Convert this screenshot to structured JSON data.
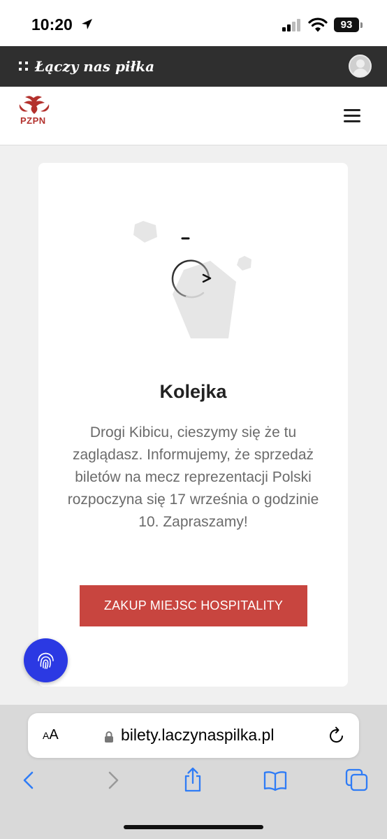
{
  "status_bar": {
    "time": "10:20",
    "battery": "93"
  },
  "brand_bar": {
    "title": "Łączy nas piłka"
  },
  "header": {
    "logo_text": "PZPN"
  },
  "queue": {
    "title": "Kolejka",
    "message": "Drogi Kibicu, cieszymy się że tu zaglądasz. Informujemy, że sprzedaż biletów na mecz reprezentacji Polski rozpoczyna się 17 września o godzinie 10. Zapraszamy!",
    "button_label": "ZAKUP MIEJSC HOSPITALITY"
  },
  "browser": {
    "text_size_small": "A",
    "text_size_large": "A",
    "url": "bilety.laczynaspilka.pl"
  },
  "colors": {
    "accent": "#c8453f",
    "brand_bar": "#2f2f2f",
    "fab": "#2b39e3",
    "link_blue": "#2f7cf6"
  },
  "icons": [
    "location-arrow-icon",
    "cellular-signal-icon",
    "wifi-icon",
    "apps-grid-icon",
    "user-avatar-icon",
    "pzpn-eagle-logo",
    "hamburger-menu-icon",
    "loading-spinner-icon",
    "fingerprint-icon",
    "lock-icon",
    "reload-icon",
    "back-icon",
    "forward-icon",
    "share-icon",
    "bookmarks-icon",
    "tabs-icon"
  ]
}
